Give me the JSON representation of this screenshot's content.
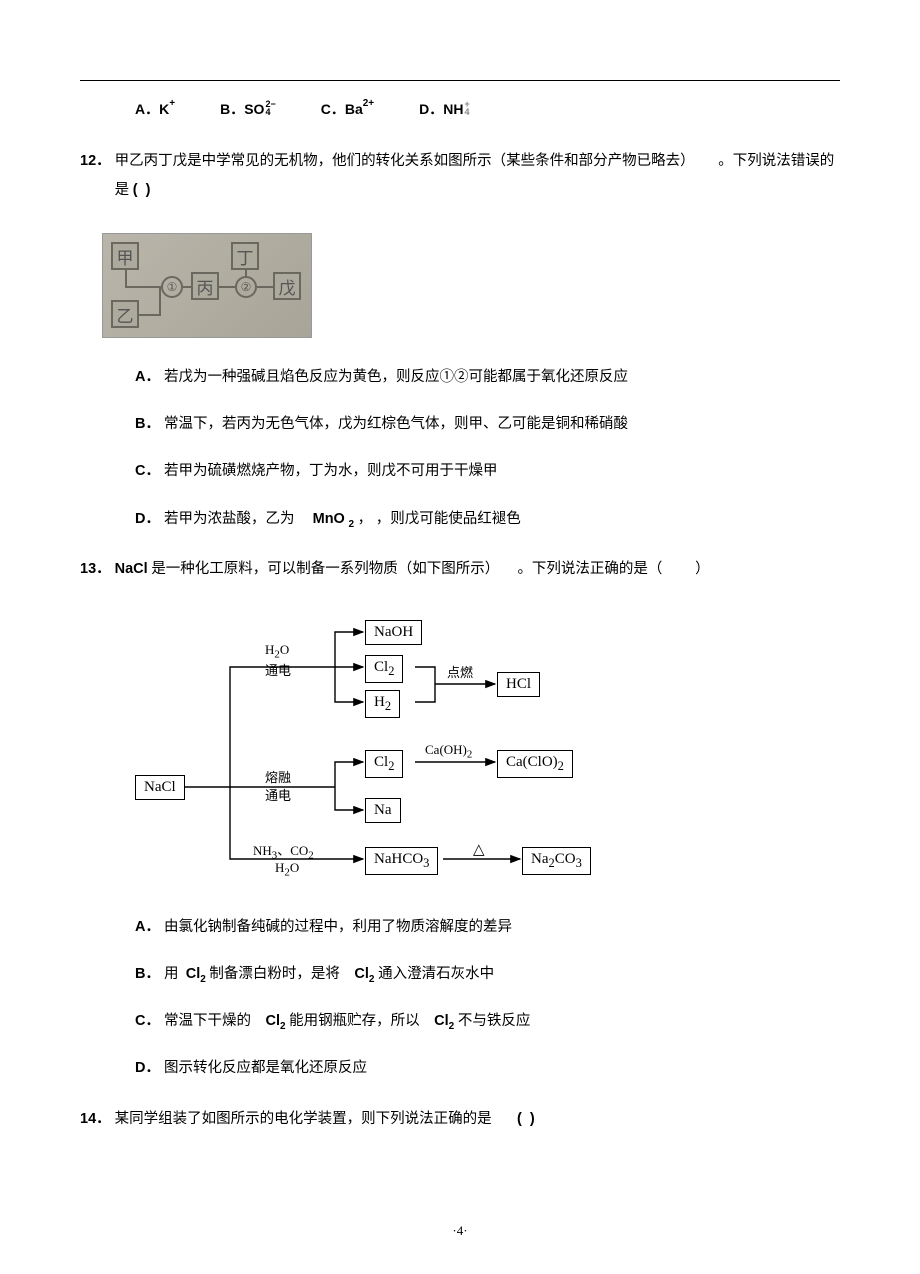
{
  "q11_options": {
    "a_label": "A．",
    "a_text": "K",
    "a_sup": "+",
    "b_label": "B．",
    "b_text": "SO",
    "b_sup": "2−",
    "b_sub": "4",
    "c_label": "C．",
    "c_text": "Ba",
    "c_sup": "2+",
    "d_label": "D．",
    "d_text": "NH",
    "d_sup": "+",
    "d_sub": "4"
  },
  "q12": {
    "num": "12．",
    "text_a": "甲乙丙丁戊是中学常见的无机物，他们的转化关系如图所示（某些条件和部分产物已略去）",
    "text_b": "。下列说法错误的是",
    "brackets": "(       )",
    "fig": {
      "jia": "甲",
      "yi": "乙",
      "bing": "丙",
      "ding": "丁",
      "wu": "戊",
      "c1": "①",
      "c2": "②"
    },
    "opts": {
      "a_label": "A．",
      "a_text": "若戊为一种强碱且焰色反应为黄色，则反应①②可能都属于氧化还原反应",
      "b_label": "B．",
      "b_text": "常温下，若丙为无色气体，戊为红棕色气体，则甲、乙可能是铜和稀硝酸",
      "c_label": "C．",
      "c_text": "若甲为硫磺燃烧产物，丁为水，则戊不可用于干燥甲",
      "d_label": "D．",
      "d_text_a": "若甲为浓盐酸，乙为",
      "d_bold": "MnO",
      "d_sub": "2",
      "d_text_b": "，则戊可能使品红褪色"
    }
  },
  "q13": {
    "num": "13．",
    "text_a": "NaCl",
    "text_b": "是一种化工原料，可以制备一系列物质（如下图所示）",
    "text_c": "。下列说法正确的是（",
    "text_d": "）",
    "fig": {
      "nacl": "NaCl",
      "naoh": "NaOH",
      "cl2a": "Cl",
      "cl2a_sub": "2",
      "h2": "H",
      "h2_sub": "2",
      "hcl": "HCl",
      "cl2b": "Cl",
      "cl2b_sub": "2",
      "na": "Na",
      "caclo2": "Ca(ClO)",
      "caclo2_sub": "2",
      "nahco3": "NaHCO",
      "nahco3_sub": "3",
      "na2co3": "Na",
      "na2co3_sub1": "2",
      "na2co3_b": "CO",
      "na2co3_sub2": "3",
      "h2o": "H",
      "h2o_sub": "2",
      "h2o_b": "O",
      "tongdian": "通电",
      "dianran": "点燃",
      "rongron": "熔融",
      "caoh2": "Ca(OH)",
      "caoh2_sub": "2",
      "nh3": "NH",
      "nh3_sub": "3",
      "co2": "、CO",
      "co2_sub": "2",
      "delta": "△",
      "h2o2": "H",
      "h2o2_sub": "2",
      "h2o2_b": "O"
    },
    "opts": {
      "a_label": "A．",
      "a_text": "由氯化钠制备纯碱的过程中，利用了物质溶解度的差异",
      "b_label": "B．",
      "b_pre": "用",
      "b_cl2a": "Cl",
      "b_cl2a_sub": "2",
      "b_mid": "制备漂白粉时，是将",
      "b_cl2b": "Cl",
      "b_cl2b_sub": "2",
      "b_post": "通入澄清石灰水中",
      "c_label": "C．",
      "c_pre": "常温下干燥的",
      "c_cl2a": "Cl",
      "c_cl2a_sub": "2",
      "c_mid": "能用钢瓶贮存，所以",
      "c_cl2b": "Cl",
      "c_cl2b_sub": "2",
      "c_post": "不与铁反应",
      "d_label": "D．",
      "d_text": "图示转化反应都是氧化还原反应"
    }
  },
  "q14": {
    "num": "14．",
    "text": "某同学组装了如图所示的电化学装置，则下列说法正确的是",
    "brackets": "(    )"
  },
  "page": "·4·"
}
